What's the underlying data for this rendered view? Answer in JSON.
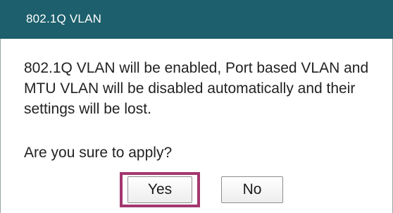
{
  "dialog": {
    "title": "802.1Q VLAN",
    "message": "802.1Q VLAN will be enabled, Port based VLAN and MTU VLAN will be disabled automatically and their settings will be lost.",
    "question": "Are you sure to apply?",
    "buttons": {
      "yes_label": "Yes",
      "no_label": "No"
    },
    "highlighted_button": "yes"
  },
  "colors": {
    "titlebar": "#1d5f6c",
    "title_text": "#ffffff",
    "highlight_border": "#a3376f",
    "body_text": "#222222"
  }
}
